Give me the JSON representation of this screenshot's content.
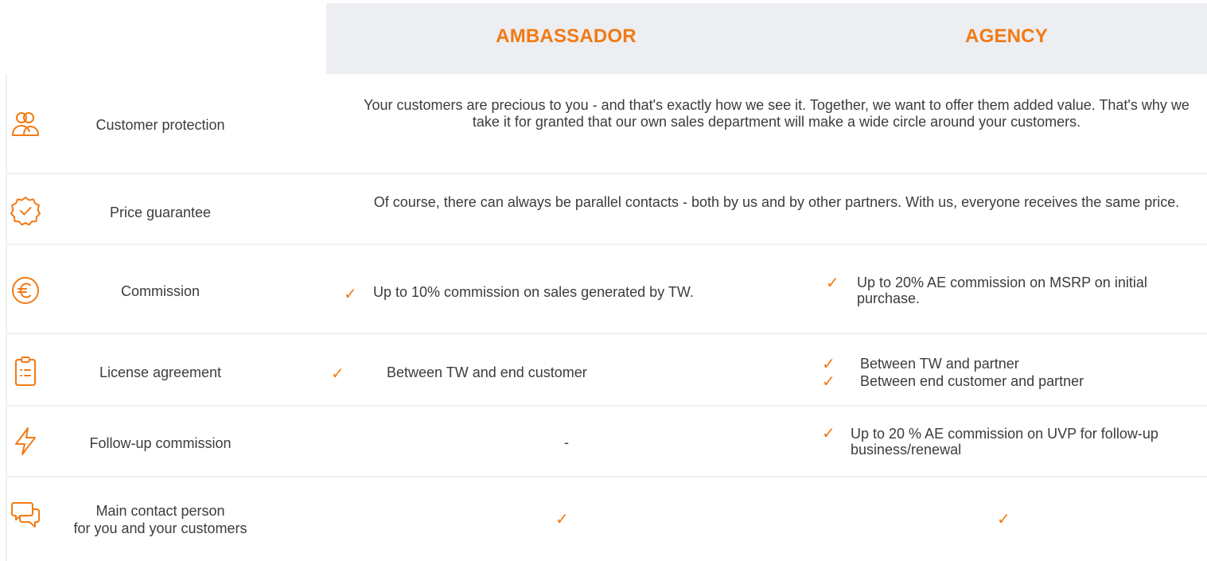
{
  "header": {
    "col1": "AMBASSADOR",
    "col2": "AGENCY"
  },
  "rows": [
    {
      "icon": "people-icon",
      "label": "Customer protection",
      "shared_text": "Your customers are precious to you - and that's exactly how we see it. Together, we want to offer them added value. That's why we take it for granted that our own sales department will make a wide circle around your customers."
    },
    {
      "icon": "badge-check-icon",
      "label": "Price guarantee",
      "shared_text": "Of course, there can always be parallel contacts - both by us and by other partners. With us, everyone receives the same price."
    },
    {
      "icon": "euro-coin-icon",
      "label": "Commission",
      "ambassador": "Up to 10% commission on sales generated by TW.",
      "agency": "Up to 20% AE commission on MSRP on initial purchase."
    },
    {
      "icon": "clipboard-list-icon",
      "label": "License agreement",
      "ambassador": "Between TW and end customer",
      "agency": [
        "Between TW and partner",
        "Between end customer and partner"
      ]
    },
    {
      "icon": "lightning-icon",
      "label": "Follow-up commission",
      "ambassador": "-",
      "agency": "Up to 20 % AE commission on UVP for follow-up business/renewal"
    },
    {
      "icon": "chat-bubbles-icon",
      "label_line1": "Main contact person",
      "label_line2": "for you and your customers"
    }
  ],
  "check_mark": "✓",
  "colors": {
    "accent": "#f27a14",
    "header_bg": "#eceef1",
    "text": "#3c3c3c",
    "divider": "#eef0f3"
  }
}
